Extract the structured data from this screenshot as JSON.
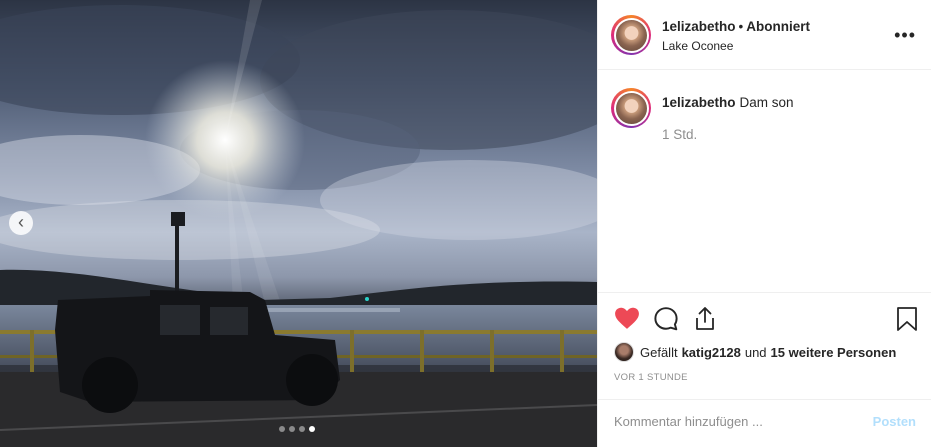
{
  "post": {
    "author": "1elizabetho",
    "separator": "•",
    "follow_status": "Abonniert",
    "location": "Lake Oconee",
    "more_label": "•••"
  },
  "caption": {
    "author": "1elizabetho",
    "text": "Dam son",
    "time": "1 Std."
  },
  "carousel": {
    "prev_icon": "‹",
    "total_dots": 4,
    "active_dot": 4
  },
  "likes": {
    "prefix": "Gefällt",
    "first_user": "katig2128",
    "connector": "und",
    "others": "15 weitere Personen"
  },
  "timestamp": "VOR 1 STUNDE",
  "comment": {
    "placeholder": "Kommentar hinzufügen ...",
    "post_label": "Posten"
  },
  "colors": {
    "like_red": "#ed4956",
    "post_disabled": "#b2dffc",
    "text_secondary": "#8e8e8e"
  },
  "icons": [
    "heart-icon",
    "comment-icon",
    "share-icon",
    "bookmark-icon",
    "more-icon",
    "chevron-left-icon"
  ]
}
